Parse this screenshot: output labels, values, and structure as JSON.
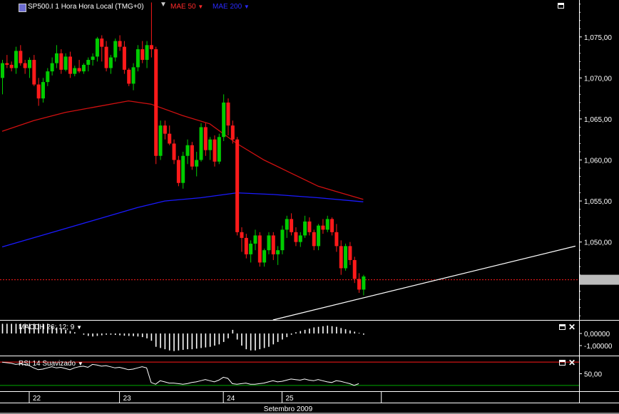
{
  "header": {
    "title": "SP500.I 1 Hora Hora Local (TMG+0)",
    "ma1_label": "MAE 50",
    "ma2_label": "MAE 200",
    "macd_label": "MACDH 26; 12; 9",
    "rsi_label": "RSI 14 Suavizado"
  },
  "colors": {
    "background": "#000000",
    "up": "#00cc00",
    "down": "#ff1a1a",
    "ma50": "#d01010",
    "ma200": "#1a1aff",
    "trendline": "#ffffff",
    "ref_line": "#ff1a1a",
    "rsi_line": "#ffffff",
    "rsi_upper": "#ff1a1a",
    "rsi_lower": "#00aa00"
  },
  "chart_data": [
    {
      "type": "candlestick",
      "title": "SP500.I 1 Hora Hora Local (TMG+0)",
      "ylim": [
        1.0405,
        1.0795
      ],
      "y_ticks": [
        "1,075,00",
        "1,070,00",
        "1,065,00",
        "1,060,00",
        "1,055,00",
        "1,050,00"
      ],
      "y_tick_values": [
        1.075,
        1.07,
        1.065,
        1.06,
        1.055,
        1.05
      ],
      "current_price": 1.0454,
      "x_tick_labels": [
        "22",
        "23",
        "24",
        "25"
      ],
      "x_axis_title": "Setembro 2009",
      "candles": [
        [
          1.07,
          1.0722,
          1.068,
          1.0718
        ],
        [
          1.0718,
          1.0728,
          1.0712,
          1.0716
        ],
        [
          1.0716,
          1.072,
          1.0708,
          1.0712
        ],
        [
          1.0712,
          1.0738,
          1.0705,
          1.0733
        ],
        [
          1.0733,
          1.074,
          1.0715,
          1.0718
        ],
        [
          1.0718,
          1.0722,
          1.0705,
          1.0712
        ],
        [
          1.0712,
          1.0725,
          1.07,
          1.0722
        ],
        [
          1.0722,
          1.0728,
          1.069,
          1.0692
        ],
        [
          1.0692,
          1.07,
          1.0666,
          1.0675
        ],
        [
          1.0675,
          1.07,
          1.067,
          1.0695
        ],
        [
          1.0695,
          1.0712,
          1.069,
          1.0708
        ],
        [
          1.0708,
          1.0725,
          1.0703,
          1.0718
        ],
        [
          1.0718,
          1.074,
          1.0712,
          1.073
        ],
        [
          1.073,
          1.0735,
          1.0705,
          1.071
        ],
        [
          1.071,
          1.073,
          1.0708,
          1.0726
        ],
        [
          1.0726,
          1.0732,
          1.07,
          1.0705
        ],
        [
          1.0705,
          1.0715,
          1.0702,
          1.0712
        ],
        [
          1.0712,
          1.0722,
          1.0706,
          1.0708
        ],
        [
          1.0708,
          1.0718,
          1.0705,
          1.0716
        ],
        [
          1.0716,
          1.0725,
          1.0708,
          1.0722
        ],
        [
          1.0722,
          1.073,
          1.0715,
          1.0726
        ],
        [
          1.0726,
          1.075,
          1.072,
          1.0748
        ],
        [
          1.0748,
          1.0752,
          1.072,
          1.0738
        ],
        [
          1.0738,
          1.0745,
          1.0708,
          1.0712
        ],
        [
          1.0712,
          1.0728,
          1.0705,
          1.0725
        ],
        [
          1.0725,
          1.0748,
          1.072,
          1.0745
        ],
        [
          1.0745,
          1.0752,
          1.0733,
          1.0738
        ],
        [
          1.0738,
          1.0745,
          1.0705,
          1.071
        ],
        [
          1.071,
          1.0712,
          1.069,
          1.0693
        ],
        [
          1.0693,
          1.0718,
          1.0685,
          1.0713
        ],
        [
          1.0713,
          1.074,
          1.0708,
          1.0735
        ],
        [
          1.0735,
          1.0745,
          1.0718,
          1.0722
        ],
        [
          1.0722,
          1.0745,
          1.0712,
          1.074
        ],
        [
          1.074,
          1.0792,
          1.0725,
          1.0735
        ],
        [
          1.0735,
          1.0738,
          1.0595,
          1.0605
        ],
        [
          1.0605,
          1.0648,
          1.06,
          1.0642
        ],
        [
          1.0642,
          1.0648,
          1.0625,
          1.0632
        ],
        [
          1.0632,
          1.0642,
          1.0618,
          1.062
        ],
        [
          1.062,
          1.0625,
          1.0595,
          1.06
        ],
        [
          1.06,
          1.0605,
          1.0568,
          1.0572
        ],
        [
          1.0572,
          1.061,
          1.0565,
          1.0605
        ],
        [
          1.0605,
          1.0625,
          1.0595,
          1.0618
        ],
        [
          1.0618,
          1.0622,
          1.0588,
          1.0592
        ],
        [
          1.0592,
          1.061,
          1.058,
          1.06
        ],
        [
          1.06,
          1.0645,
          1.0598,
          1.064
        ],
        [
          1.064,
          1.0645,
          1.0605,
          1.0612
        ],
        [
          1.0612,
          1.0628,
          1.06,
          1.0625
        ],
        [
          1.0625,
          1.063,
          1.0592,
          1.0598
        ],
        [
          1.0598,
          1.0632,
          1.0595,
          1.0628
        ],
        [
          1.0628,
          1.068,
          1.0623,
          1.067
        ],
        [
          1.067,
          1.0675,
          1.063,
          1.0642
        ],
        [
          1.0642,
          1.0648,
          1.062,
          1.0625
        ],
        [
          1.0625,
          1.0628,
          1.0508,
          1.0512
        ],
        [
          1.0512,
          1.0518,
          1.0488,
          1.0505
        ],
        [
          1.0505,
          1.051,
          1.048,
          1.0485
        ],
        [
          1.0485,
          1.0502,
          1.0475,
          1.0498
        ],
        [
          1.0498,
          1.0515,
          1.049,
          1.0508
        ],
        [
          1.0508,
          1.0512,
          1.047,
          1.0475
        ],
        [
          1.0475,
          1.0492,
          1.047,
          1.049
        ],
        [
          1.049,
          1.0512,
          1.0485,
          1.0508
        ],
        [
          1.0508,
          1.0512,
          1.0478,
          1.0485
        ],
        [
          1.0485,
          1.0495,
          1.0472,
          1.049
        ],
        [
          1.049,
          1.052,
          1.0485,
          1.0515
        ],
        [
          1.0515,
          1.0532,
          1.0505,
          1.0528
        ],
        [
          1.0528,
          1.0535,
          1.0508,
          1.0512
        ],
        [
          1.0512,
          1.0518,
          1.0495,
          1.05
        ],
        [
          1.05,
          1.0512,
          1.0494,
          1.0508
        ],
        [
          1.0508,
          1.0532,
          1.0505,
          1.0525
        ],
        [
          1.0525,
          1.053,
          1.0508,
          1.0512
        ],
        [
          1.0512,
          1.0515,
          1.049,
          1.0495
        ],
        [
          1.0495,
          1.0522,
          1.049,
          1.052
        ],
        [
          1.052,
          1.0528,
          1.051,
          1.0515
        ],
        [
          1.0515,
          1.0532,
          1.0512,
          1.0528
        ],
        [
          1.0528,
          1.053,
          1.0508,
          1.0512
        ],
        [
          1.0512,
          1.0522,
          1.0488,
          1.0495
        ],
        [
          1.0495,
          1.0502,
          1.046,
          1.0468
        ],
        [
          1.0468,
          1.0498,
          1.0465,
          1.0495
        ],
        [
          1.0495,
          1.05,
          1.0472,
          1.0478
        ],
        [
          1.0478,
          1.0482,
          1.045,
          1.0455
        ],
        [
          1.0455,
          1.0462,
          1.0438,
          1.0442
        ],
        [
          1.0442,
          1.046,
          1.0435,
          1.0458
        ]
      ],
      "ma50": [
        [
          0,
          1.0635
        ],
        [
          7,
          1.0648
        ],
        [
          14,
          1.0658
        ],
        [
          21,
          1.0665
        ],
        [
          28,
          1.0672
        ],
        [
          33,
          1.0668
        ],
        [
          40,
          1.0654
        ],
        [
          46,
          1.0644
        ],
        [
          52,
          1.062
        ],
        [
          58,
          1.06
        ],
        [
          64,
          1.0584
        ],
        [
          70,
          1.0568
        ],
        [
          75,
          1.056
        ],
        [
          80,
          1.0552
        ]
      ],
      "ma200": [
        [
          0,
          1.0494
        ],
        [
          10,
          1.051
        ],
        [
          20,
          1.0526
        ],
        [
          30,
          1.0542
        ],
        [
          36,
          1.055
        ],
        [
          44,
          1.0554
        ],
        [
          52,
          1.056
        ],
        [
          60,
          1.0558
        ],
        [
          70,
          1.0554
        ],
        [
          80,
          1.0549
        ]
      ],
      "trendline": [
        [
          60,
          1.0405
        ],
        [
          127,
          1.0495
        ]
      ]
    },
    {
      "type": "bar",
      "title": "MACDH 26; 12; 9",
      "y_ticks": [
        "0,00000",
        "-1,00000"
      ],
      "y_tick_values": [
        0,
        -1
      ],
      "values": [
        0.8,
        0.8,
        0.8,
        0.8,
        0.8,
        0.8,
        0.8,
        0.8,
        0.8,
        0.8,
        0.8,
        0.6,
        0.5,
        0.4,
        0.3,
        0.2,
        0.1,
        0,
        -0.1,
        -0.2,
        -0.25,
        -0.2,
        -0.15,
        -0.1,
        -0.1,
        -0.12,
        -0.15,
        -0.18,
        -0.2,
        -0.22,
        -0.25,
        -0.3,
        -0.4,
        -0.6,
        -1.1,
        -1.2,
        -1.3,
        -1.4,
        -1.45,
        -1.4,
        -1.35,
        -1.3,
        -1.3,
        -1.25,
        -1.2,
        -1.15,
        -1.1,
        -1.0,
        -0.9,
        -0.7,
        -0.4,
        0.3,
        -0.5,
        -1.0,
        -1.3,
        -1.4,
        -1.4,
        -1.3,
        -1.2,
        -1.1,
        -0.9,
        -0.7,
        -0.5,
        -0.3,
        -0.1,
        0.1,
        0.2,
        0.3,
        0.4,
        0.5,
        0.55,
        0.6,
        0.65,
        0.6,
        0.55,
        0.45,
        0.35,
        0.25,
        0.15,
        0.05,
        -0.1
      ]
    },
    {
      "type": "line",
      "title": "RSI 14 Suavizado",
      "y_ticks": [
        "50,00"
      ],
      "y_tick_values": [
        50
      ],
      "ylim": [
        20,
        80
      ],
      "upper_level": 70,
      "lower_level": 30,
      "values": [
        70,
        69,
        68,
        66,
        67,
        66,
        64,
        60,
        57,
        58,
        60,
        62,
        60,
        61,
        59,
        57,
        60,
        62,
        63,
        61,
        66,
        65,
        63,
        64,
        62,
        60,
        61,
        59,
        57,
        58,
        60,
        62,
        60,
        35,
        32,
        38,
        36,
        34,
        34,
        33,
        32,
        33,
        35,
        36,
        38,
        40,
        38,
        36,
        39,
        44,
        42,
        33,
        32,
        33,
        34,
        32,
        32,
        33,
        34,
        36,
        38,
        36,
        37,
        39,
        41,
        40,
        39,
        41,
        39,
        38,
        40,
        38,
        36,
        35,
        38,
        37,
        35,
        33,
        30,
        33
      ]
    }
  ]
}
